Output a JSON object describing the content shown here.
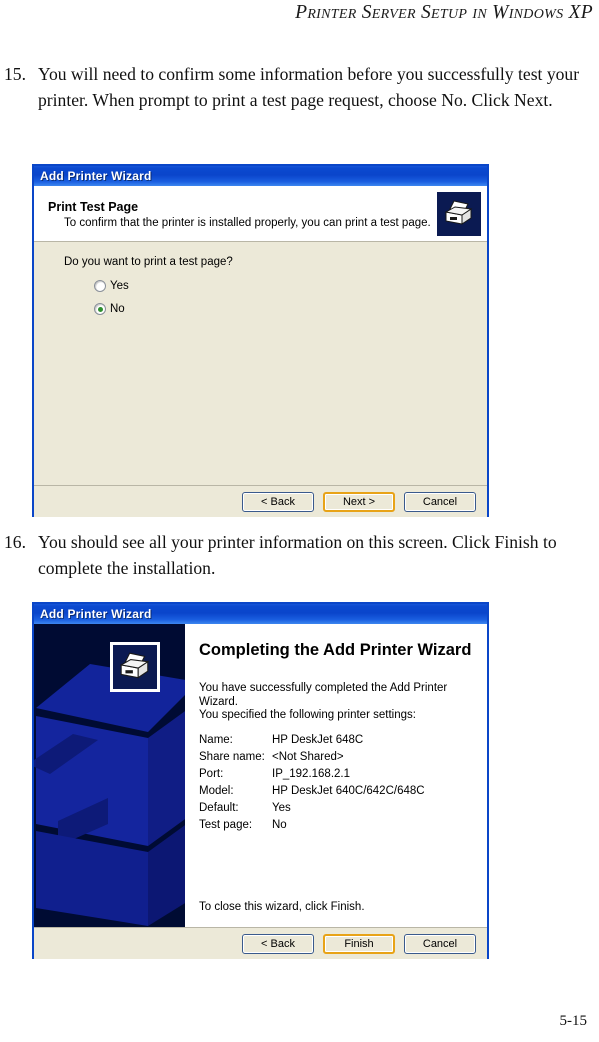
{
  "page": {
    "running_head": "Printer Server Setup in Windows XP",
    "folio": "5-15"
  },
  "steps": [
    {
      "number": "15.",
      "text": "You will need to confirm some information before you successfully test your printer. When prompt to print a test page request, choose No. Click Next."
    },
    {
      "number": "16.",
      "text": "You should see all your printer information on this screen. Click Finish to complete the installation."
    }
  ],
  "wizard_test_page": {
    "titlebar": "Add Printer Wizard",
    "header_title": "Print Test Page",
    "header_subtitle": "To confirm that the printer is installed properly, you can print a test page.",
    "question": "Do you want to print a test page?",
    "options": [
      {
        "label": "Yes",
        "selected": false
      },
      {
        "label": "No",
        "selected": true
      }
    ],
    "buttons": [
      {
        "label": "< Back",
        "focused": false
      },
      {
        "label": "Next >",
        "focused": true
      },
      {
        "label": "Cancel",
        "focused": false
      }
    ]
  },
  "wizard_complete": {
    "titlebar": "Add Printer Wizard",
    "title": "Completing the Add Printer Wizard",
    "intro_line1": "You have successfully completed the Add Printer Wizard.",
    "intro_line2": "You specified the following printer settings:",
    "settings": [
      {
        "key": "Name:",
        "value": "HP DeskJet 648C"
      },
      {
        "key": "Share name:",
        "value": "<Not Shared>"
      },
      {
        "key": "Port:",
        "value": "IP_192.168.2.1"
      },
      {
        "key": "Model:",
        "value": "HP DeskJet 640C/642C/648C"
      },
      {
        "key": "Default:",
        "value": "Yes"
      },
      {
        "key": "Test page:",
        "value": "No"
      }
    ],
    "close_text": "To close this wizard, click Finish.",
    "buttons": [
      {
        "label": "< Back",
        "focused": false
      },
      {
        "label": "Finish",
        "focused": true
      },
      {
        "label": "Cancel",
        "focused": false
      }
    ]
  },
  "colors": {
    "titlebar_blue": "#0A45CB",
    "dialog_border": "#0A46C8",
    "dialog_body": "#ECE9D8",
    "banner_navy": "#000B33",
    "watermark_blue": "#12249B",
    "focus_orange": "#E8A317",
    "radio_green": "#2F8F2F"
  }
}
